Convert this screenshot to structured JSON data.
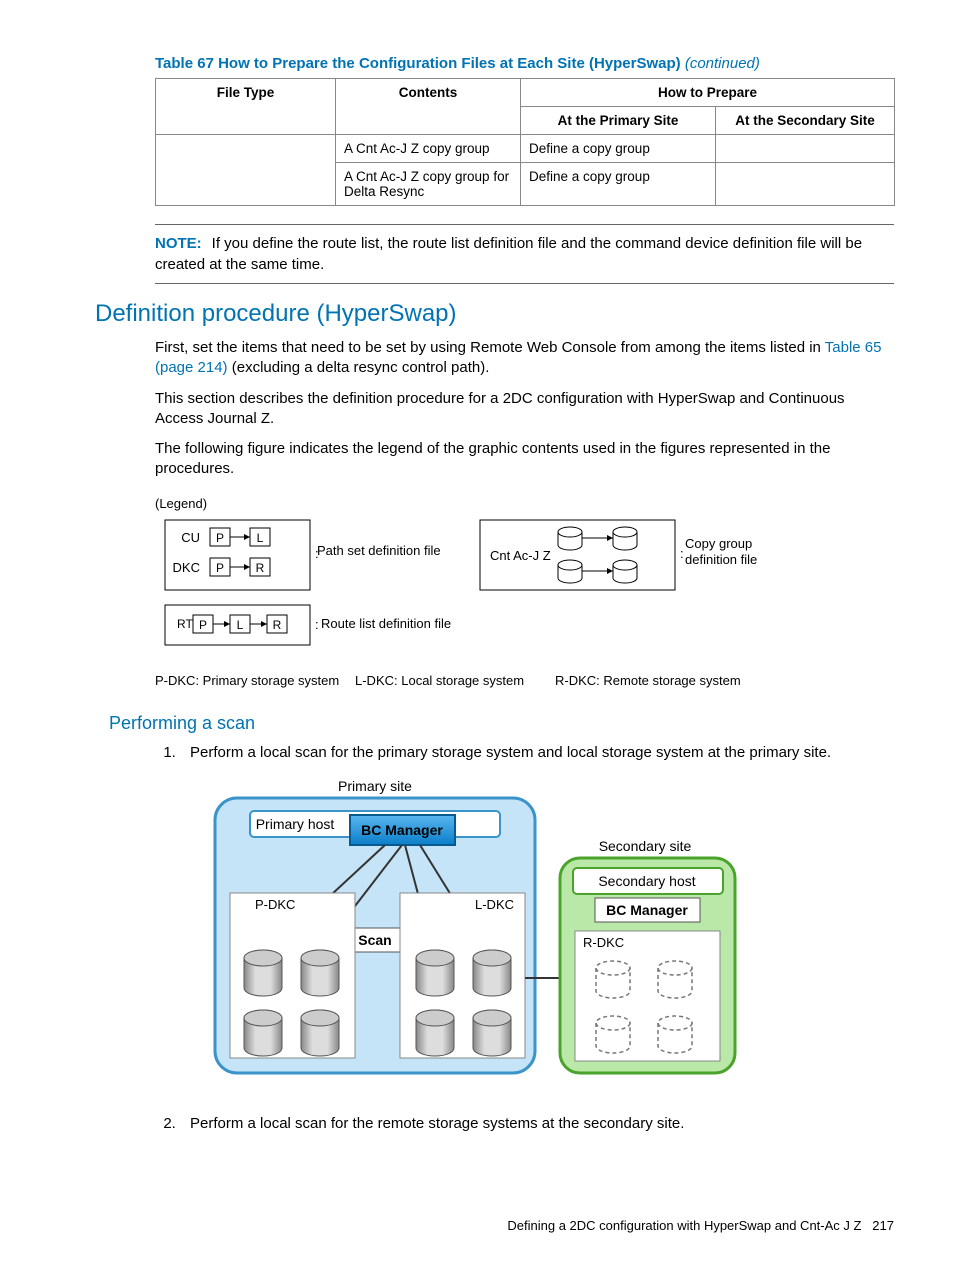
{
  "table": {
    "caption_prefix": "Table 67 How to Prepare the Configuration Files at Each Site (HyperSwap) ",
    "caption_suffix": "(continued)",
    "headers": {
      "file_type": "File Type",
      "contents": "Contents",
      "how_to_prepare": "How to Prepare",
      "primary": "At the Primary Site",
      "secondary": "At the Secondary Site"
    },
    "rows": [
      {
        "contents": "A Cnt Ac-J Z copy group",
        "primary": "Define a copy group",
        "secondary": ""
      },
      {
        "contents": "A Cnt Ac-J Z copy group for Delta Resync",
        "primary": "Define a copy group",
        "secondary": ""
      }
    ]
  },
  "note": {
    "label": "NOTE:",
    "text": "If you define the route list, the route list definition file and the command device definition file will be created at the same time."
  },
  "section_h2": "Definition procedure (HyperSwap)",
  "para1_pre": "First, set the items that need to be set by using Remote Web Console from among the items listed in ",
  "para1_link": "Table 65 (page 214)",
  "para1_post": " (excluding a delta resync control path).",
  "para2": "This section describes the definition procedure for a 2DC configuration with HyperSwap and Continuous Access Journal Z.",
  "para3": "The following figure indicates the legend of the graphic contents used in the figures represented in the procedures.",
  "legend": {
    "title": "(Legend)",
    "cu": "CU",
    "dkc": "DKC",
    "rt": "RT",
    "p": "P",
    "l": "L",
    "r": "R",
    "pathset": "Path set definition file",
    "cntacj": "Cnt Ac-J Z",
    "copygroup1": "Copy group",
    "copygroup2": "definition file",
    "routelist": "Route list definition file",
    "pdkc": "P-DKC: Primary storage system",
    "ldkc": "L-DKC: Local storage system",
    "rdkc": "R-DKC: Remote storage system"
  },
  "subsection_h3": "Performing a scan",
  "steps": {
    "s1": "Perform a local scan for the primary storage system and local storage system at the primary site.",
    "s2": "Perform a local scan for the remote storage systems at the secondary site."
  },
  "diagram": {
    "primary_site": "Primary site",
    "primary_host": "Primary host",
    "bc_manager": "BC Manager",
    "pdkc": "P-DKC",
    "ldkc": "L-DKC",
    "scan": "Scan",
    "secondary_site": "Secondary site",
    "secondary_host": "Secondary host",
    "rdkc": "R-DKC"
  },
  "footer": {
    "text": "Defining a 2DC configuration with HyperSwap and Cnt-Ac J Z",
    "page": "217"
  }
}
